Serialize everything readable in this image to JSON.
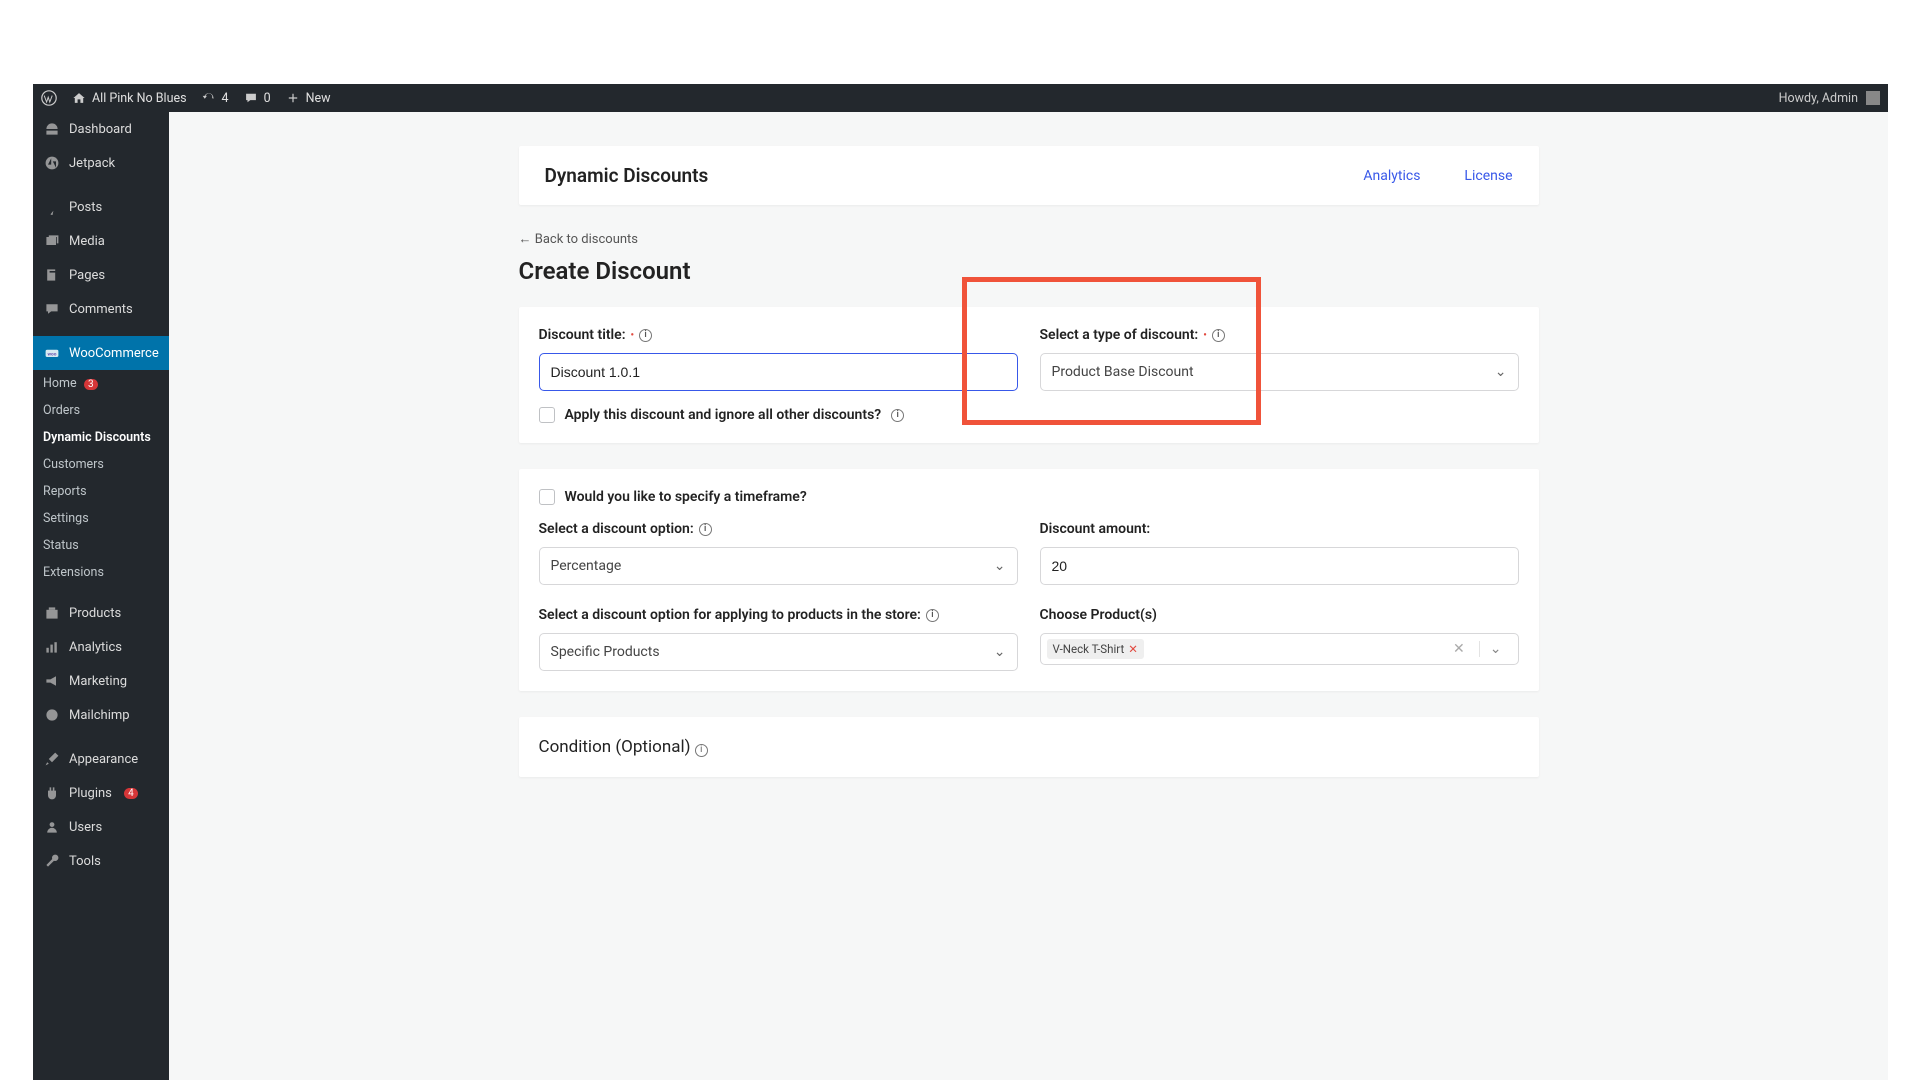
{
  "adminbar": {
    "site_name": "All Pink No Blues",
    "updates": "4",
    "comments": "0",
    "new_label": "New",
    "howdy": "Howdy, Admin"
  },
  "sidebar": {
    "dashboard": "Dashboard",
    "jetpack": "Jetpack",
    "posts": "Posts",
    "media": "Media",
    "pages": "Pages",
    "comments": "Comments",
    "woocommerce": "WooCommerce",
    "woo_sub": {
      "home": "Home",
      "home_badge": "3",
      "orders": "Orders",
      "dynamic_discounts": "Dynamic Discounts",
      "customers": "Customers",
      "reports": "Reports",
      "settings": "Settings",
      "status": "Status",
      "extensions": "Extensions"
    },
    "products": "Products",
    "analytics": "Analytics",
    "marketing": "Marketing",
    "mailchimp": "Mailchimp",
    "appearance": "Appearance",
    "plugins": "Plugins",
    "plugins_badge": "4",
    "users": "Users",
    "tools": "Tools"
  },
  "header": {
    "title": "Dynamic Discounts",
    "analytics_link": "Analytics",
    "license_link": "License"
  },
  "page": {
    "back": "← Back to discounts",
    "title": "Create Discount"
  },
  "form": {
    "discount_title_label": "Discount title:",
    "discount_title_value": "Discount 1.0.1",
    "type_label": "Select a type of discount:",
    "type_value": "Product Base Discount",
    "ignore_label": "Apply this discount and ignore all other discounts?",
    "timeframe_label": "Would you like to specify a timeframe?",
    "discount_option_label": "Select a discount option:",
    "discount_option_value": "Percentage",
    "amount_label": "Discount amount:",
    "amount_value": "20",
    "apply_option_label": "Select a discount option for applying to products in the store:",
    "apply_option_value": "Specific Products",
    "choose_products_label": "Choose Product(s)",
    "product_tag": "V-Neck T-Shirt",
    "condition_label": "Condition (Optional)"
  }
}
